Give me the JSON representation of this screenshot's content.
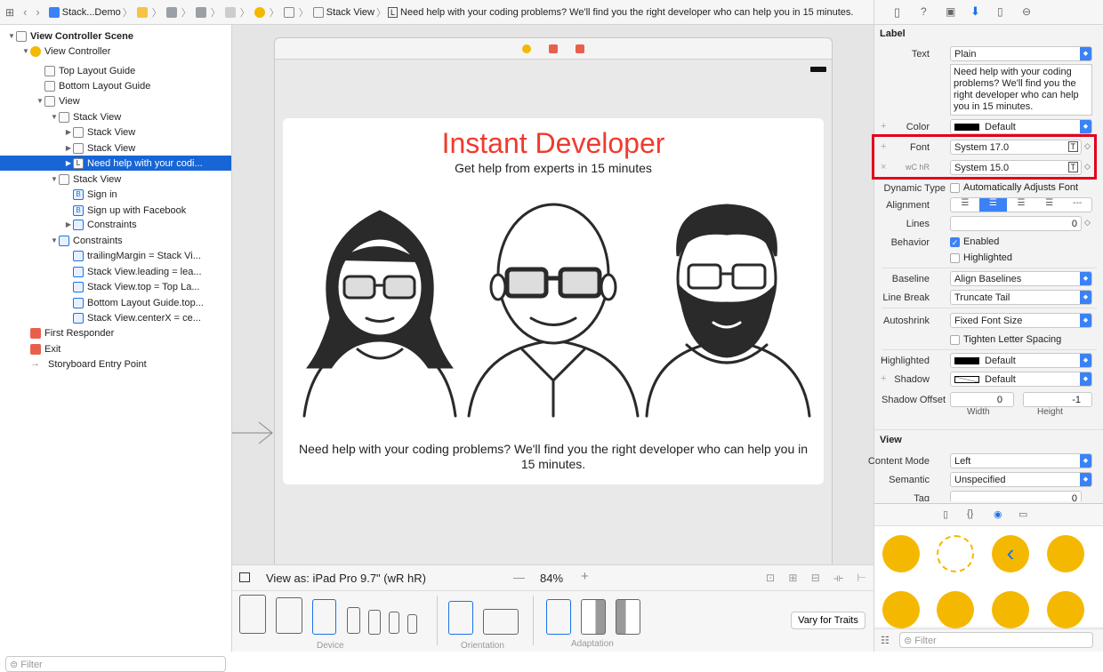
{
  "breadcrumb": {
    "items": [
      "Stack...Demo",
      "Stack View",
      "L",
      "Need help with your coding problems? We'll find you the right developer who can help you in 15 minutes."
    ]
  },
  "outline": {
    "rows": [
      {
        "label": "View Controller Scene",
        "indent": 0,
        "tri": "▼",
        "icon": "scene-icon"
      },
      {
        "label": "View Controller",
        "indent": 1,
        "tri": "▼",
        "icon": "view-controller-icon"
      },
      {
        "label": "Top Layout Guide",
        "indent": 2,
        "tri": "",
        "icon": "layout-guide-icon"
      },
      {
        "label": "Bottom Layout Guide",
        "indent": 2,
        "tri": "",
        "icon": "layout-guide-icon"
      },
      {
        "label": "View",
        "indent": 2,
        "tri": "▼",
        "icon": "view-icon"
      },
      {
        "label": "Stack View",
        "indent": 3,
        "tri": "▼",
        "icon": "stack-view-icon"
      },
      {
        "label": "Stack View",
        "indent": 4,
        "tri": "▶",
        "icon": "stack-view-icon"
      },
      {
        "label": "Stack View",
        "indent": 4,
        "tri": "▶",
        "icon": "stack-view-icon"
      },
      {
        "label": "Need help with your codi...",
        "indent": 4,
        "tri": "▶",
        "icon": "label-icon",
        "selected": true
      },
      {
        "label": "Stack View",
        "indent": 3,
        "tri": "▼",
        "icon": "stack-view-icon"
      },
      {
        "label": "Sign in",
        "indent": 4,
        "tri": "",
        "icon": "button-icon"
      },
      {
        "label": "Sign up with Facebook",
        "indent": 4,
        "tri": "",
        "icon": "button-icon"
      },
      {
        "label": "Constraints",
        "indent": 4,
        "tri": "▶",
        "icon": "constraints-icon"
      },
      {
        "label": "Constraints",
        "indent": 3,
        "tri": "▼",
        "icon": "constraints-icon"
      },
      {
        "label": "trailingMargin = Stack Vi...",
        "indent": 4,
        "tri": "",
        "icon": "constraint-icon"
      },
      {
        "label": "Stack View.leading = lea...",
        "indent": 4,
        "tri": "",
        "icon": "constraint-icon"
      },
      {
        "label": "Stack View.top = Top La...",
        "indent": 4,
        "tri": "",
        "icon": "constraint-icon"
      },
      {
        "label": "Bottom Layout Guide.top...",
        "indent": 4,
        "tri": "",
        "icon": "constraint-icon"
      },
      {
        "label": "Stack View.centerX = ce...",
        "indent": 4,
        "tri": "",
        "icon": "constraint-icon"
      },
      {
        "label": "First Responder",
        "indent": 1,
        "tri": "",
        "icon": "first-responder-icon"
      },
      {
        "label": "Exit",
        "indent": 1,
        "tri": "",
        "icon": "exit-icon"
      },
      {
        "label": "Storyboard Entry Point",
        "indent": 1,
        "tri": "",
        "icon": "entry-point-arrow-icon"
      }
    ],
    "filter_placeholder": "Filter"
  },
  "canvas": {
    "title": "Instant Developer",
    "subtitle": "Get help from experts in 15 minutes",
    "description": "Need help with your coding problems? We'll find you the right developer who can help you in 15 minutes."
  },
  "bottombar": {
    "view_as": "View as: iPad Pro 9.7\" (wR hR)",
    "zoom_minus": "—",
    "zoom": "84%",
    "zoom_plus": "+",
    "device_label": "Device",
    "orientation_label": "Orientation",
    "adaptation_label": "Adaptation",
    "vary_button": "Vary for Traits"
  },
  "inspector": {
    "label_section": "Label",
    "text_label": "Text",
    "text_value": "Plain",
    "text_content": "Need help with your coding problems? We'll find you the right developer who can help you in 15 minutes.",
    "color_label": "Color",
    "color_value": "Default",
    "font_label": "Font",
    "font_value": "System 17.0",
    "font2_label": "wC hR",
    "font2_value": "System 15.0",
    "dynamic_type_label": "Dynamic Type",
    "dynamic_type_value": "Automatically Adjusts Font",
    "alignment_label": "Alignment",
    "lines_label": "Lines",
    "lines_value": "0",
    "behavior_label": "Behavior",
    "enabled": "Enabled",
    "highlighted_cb": "Highlighted",
    "baseline_label": "Baseline",
    "baseline_value": "Align Baselines",
    "linebreak_label": "Line Break",
    "linebreak_value": "Truncate Tail",
    "autoshrink_label": "Autoshrink",
    "autoshrink_value": "Fixed Font Size",
    "tighten": "Tighten Letter Spacing",
    "highlighted_label": "Highlighted",
    "highlighted_value": "Default",
    "shadow_label": "Shadow",
    "shadow_value": "Default",
    "shadow_offset_label": "Shadow Offset",
    "shadow_w": "0",
    "shadow_h": "-1",
    "width_label": "Width",
    "height_label": "Height",
    "view_section": "View",
    "content_mode_label": "Content Mode",
    "content_mode_value": "Left",
    "semantic_label": "Semantic",
    "semantic_value": "Unspecified",
    "tag_label": "Tag",
    "tag_value": "0",
    "lib_filter_placeholder": "Filter"
  },
  "colors": {
    "accent": "#1865d6",
    "title_red": "#f03a2e",
    "highlight_box": "#e3001b"
  }
}
